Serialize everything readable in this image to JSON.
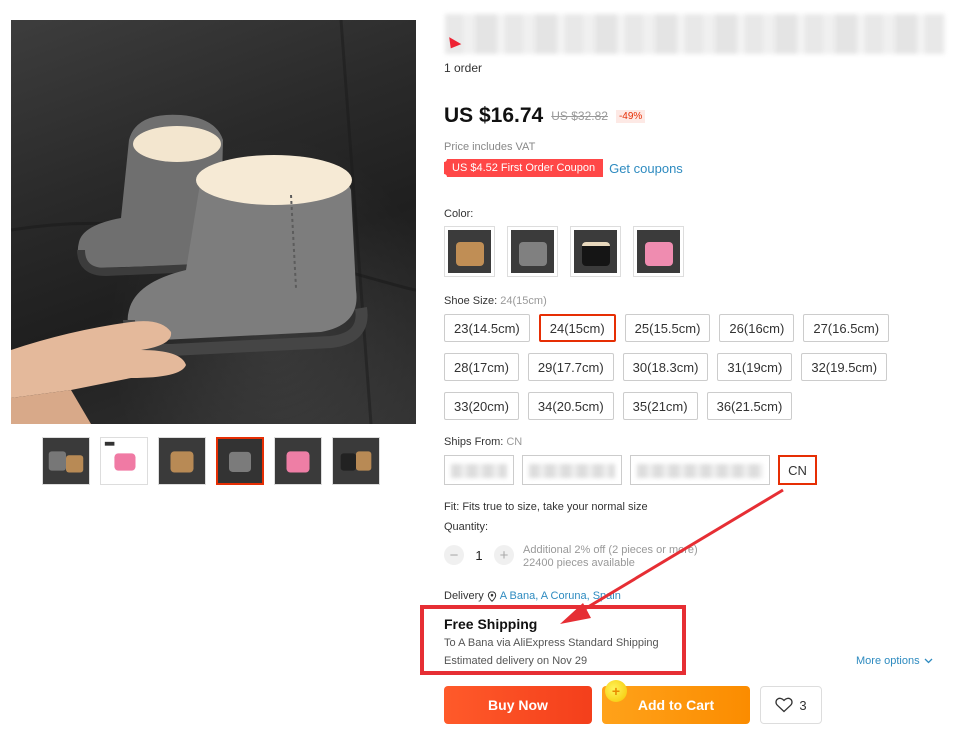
{
  "product": {
    "orders": "1 order",
    "price": "US $16.74",
    "old_price": "US $32.82",
    "discount": "-49%",
    "vat_note": "Price includes VAT",
    "coupon": "US $4.52 First Order Coupon",
    "get_coupons": "Get coupons"
  },
  "gallery": {
    "thumbnails": [
      "gray-tan boot",
      "pink boot",
      "tan boot",
      "gray boot",
      "pink boot",
      "black-tan boot"
    ],
    "active_index": 3
  },
  "color": {
    "label": "Color:",
    "options": [
      "tan",
      "gray",
      "black",
      "pink"
    ]
  },
  "size": {
    "label": "Shoe Size:",
    "selected": "24(15cm)",
    "options": [
      "23(14.5cm)",
      "24(15cm)",
      "25(15.5cm)",
      "26(16cm)",
      "27(16.5cm)",
      "28(17cm)",
      "29(17.7cm)",
      "30(18.3cm)",
      "31(19cm)",
      "32(19.5cm)",
      "33(20cm)",
      "34(20.5cm)",
      "35(21cm)",
      "36(21.5cm)"
    ]
  },
  "ships_from": {
    "label": "Ships From:",
    "selected": "CN",
    "cn": "CN"
  },
  "fit": "Fit: Fits true to size, take your normal size",
  "quantity": {
    "label": "Quantity:",
    "value": "1",
    "minus": "−",
    "plus": "+",
    "discount_info": "Additional 2% off (2 pieces or more)",
    "available": "22400 pieces available"
  },
  "delivery": {
    "label": "Delivery",
    "location": "A Bana, A Coruna, Spain",
    "free_shipping": "Free Shipping",
    "via": "To A Bana via AliExpress Standard Shipping",
    "estimate": "Estimated delivery on Nov 29",
    "more_options": "More options"
  },
  "actions": {
    "buy_now": "Buy Now",
    "add_to_cart": "Add to Cart",
    "wishlist_count": "3"
  },
  "colors": {
    "accent": "#e62e04",
    "link": "#2e8bc0",
    "buy_now": "#f43f1b",
    "add_to_cart": "#fb8c00",
    "annotation": "#e62e34"
  }
}
